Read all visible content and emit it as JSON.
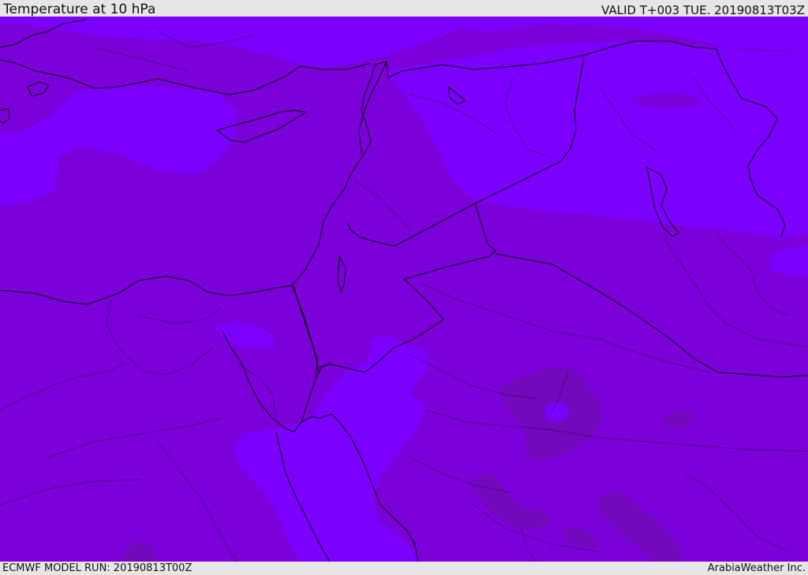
{
  "header": {
    "title": "Temperature at 10 hPa",
    "valid": "VALID T+003 TUE. 20190813T03Z"
  },
  "footer": {
    "model_run": "ECMWF MODEL RUN: 20190813T00Z",
    "credit": "ArabiaWeather Inc."
  },
  "colors": {
    "base_band": "#7b00d9",
    "light_band": "#7c00fe",
    "dark_band": "#7209bd",
    "border_line": "#000000",
    "bar_background": "#e6e6e6"
  }
}
